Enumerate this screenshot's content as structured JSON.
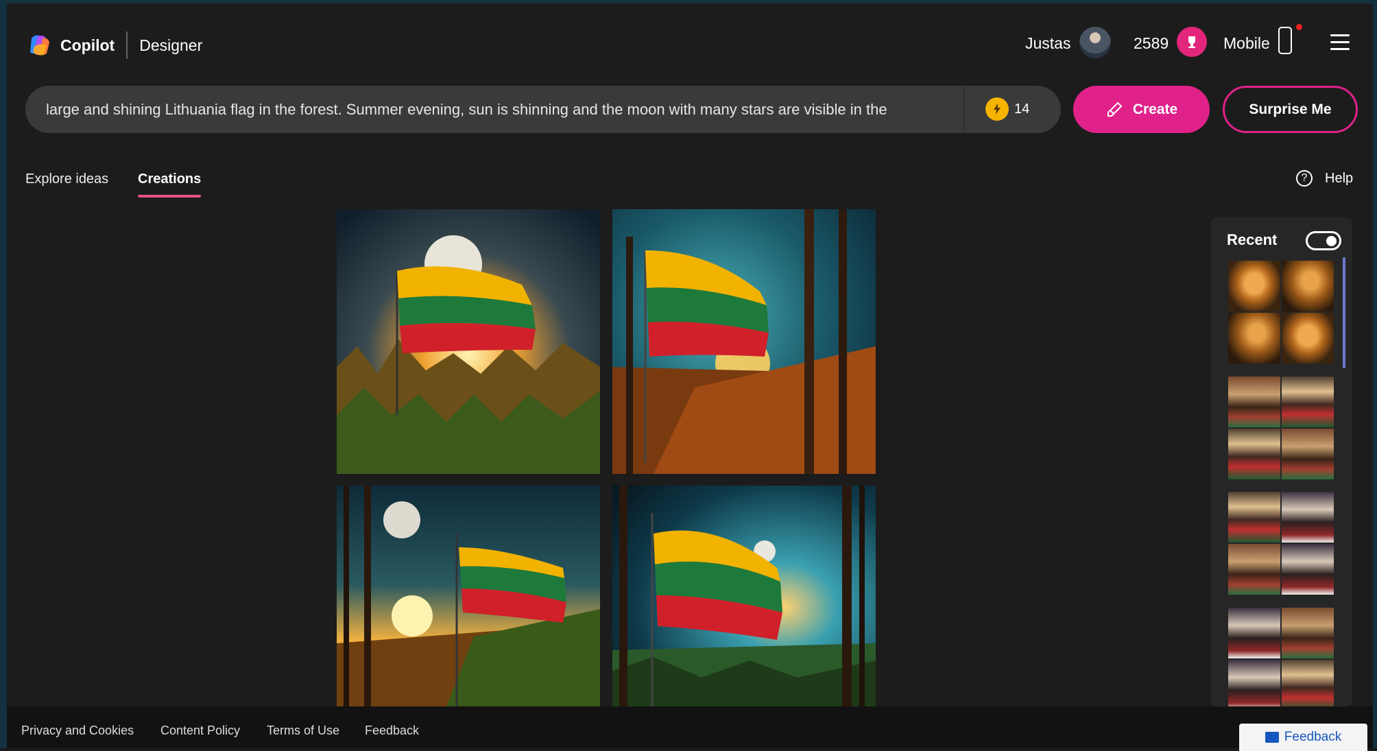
{
  "header": {
    "brand": "Copilot",
    "product": "Designer",
    "user_name": "Justas",
    "points": "2589",
    "mobile_label": "Mobile"
  },
  "prompt": {
    "value": "large and shining Lithuania flag in the forest. Summer evening, sun is shinning and the moon with many stars are visible in the",
    "boosts": "14"
  },
  "buttons": {
    "create": "Create",
    "surprise": "Surprise Me"
  },
  "tabs": [
    {
      "label": "Explore ideas",
      "active": false
    },
    {
      "label": "Creations",
      "active": true
    }
  ],
  "help_label": "Help",
  "recent": {
    "title": "Recent",
    "toggle_on": true
  },
  "footer": {
    "links": [
      "Privacy and Cookies",
      "Content Policy",
      "Terms of Use",
      "Feedback"
    ],
    "feedback_button": "Feedback"
  },
  "colors": {
    "accent": "#e0218a",
    "tab_underline": "#e75480",
    "background": "#1c1c1c",
    "flag_yellow": "#f2b200",
    "flag_green": "#1e7a3a",
    "flag_red": "#d0202a"
  },
  "icons": [
    "copilot-logo-icon",
    "avatar",
    "reward-icon",
    "phone-icon",
    "menu-icon",
    "boost-icon",
    "create-brush-icon",
    "help-icon",
    "toggle",
    "feedback-icon"
  ]
}
